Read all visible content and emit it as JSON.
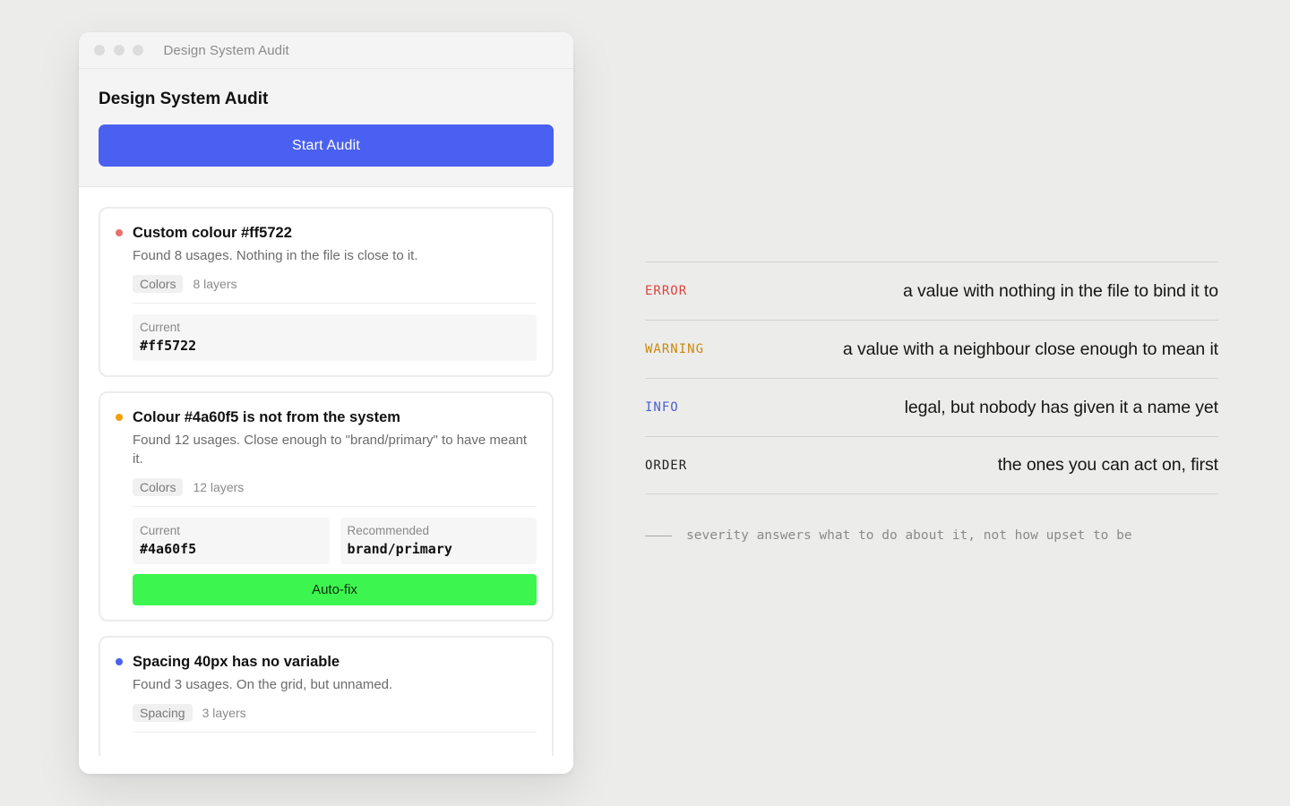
{
  "window": {
    "title": "Design System Audit"
  },
  "header": {
    "title": "Design System Audit",
    "start_button": "Start Audit"
  },
  "colors": {
    "error": "#e8716b",
    "warning": "#f59e0b",
    "info": "#4a60f0",
    "primary_button": "#4a60f0",
    "autofix_button": "#3cf54f"
  },
  "issues": [
    {
      "severity": "error",
      "title": "Custom colour #ff5722",
      "description": "Found 8 usages. Nothing in the file is close to it.",
      "tag": "Colors",
      "layers": "8 layers",
      "current_label": "Current",
      "current_value": "#ff5722"
    },
    {
      "severity": "warning",
      "title": "Colour #4a60f5 is not from the system",
      "description": "Found 12 usages. Close enough to \"brand/primary\" to have meant it.",
      "tag": "Colors",
      "layers": "12 layers",
      "current_label": "Current",
      "current_value": "#4a60f5",
      "recommended_label": "Recommended",
      "recommended_value": "brand/primary",
      "autofix_label": "Auto-fix"
    },
    {
      "severity": "info",
      "title": "Spacing 40px has no variable",
      "description": "Found 3 usages. On the grid, but unnamed.",
      "tag": "Spacing",
      "layers": "3 layers"
    }
  ],
  "legend": [
    {
      "key": "ERROR",
      "color": "#d9463e",
      "desc": "a value with nothing in the file to bind it to"
    },
    {
      "key": "WARNING",
      "color": "#c98a0e",
      "desc": "a value with a neighbour close enough to mean it"
    },
    {
      "key": "INFO",
      "color": "#4a60d0",
      "desc": "legal, but nobody has given it a name yet"
    },
    {
      "key": "ORDER",
      "color": "#222222",
      "desc": "the ones you can act on, first"
    }
  ],
  "footnote": "severity answers what to do about it, not how upset to be"
}
